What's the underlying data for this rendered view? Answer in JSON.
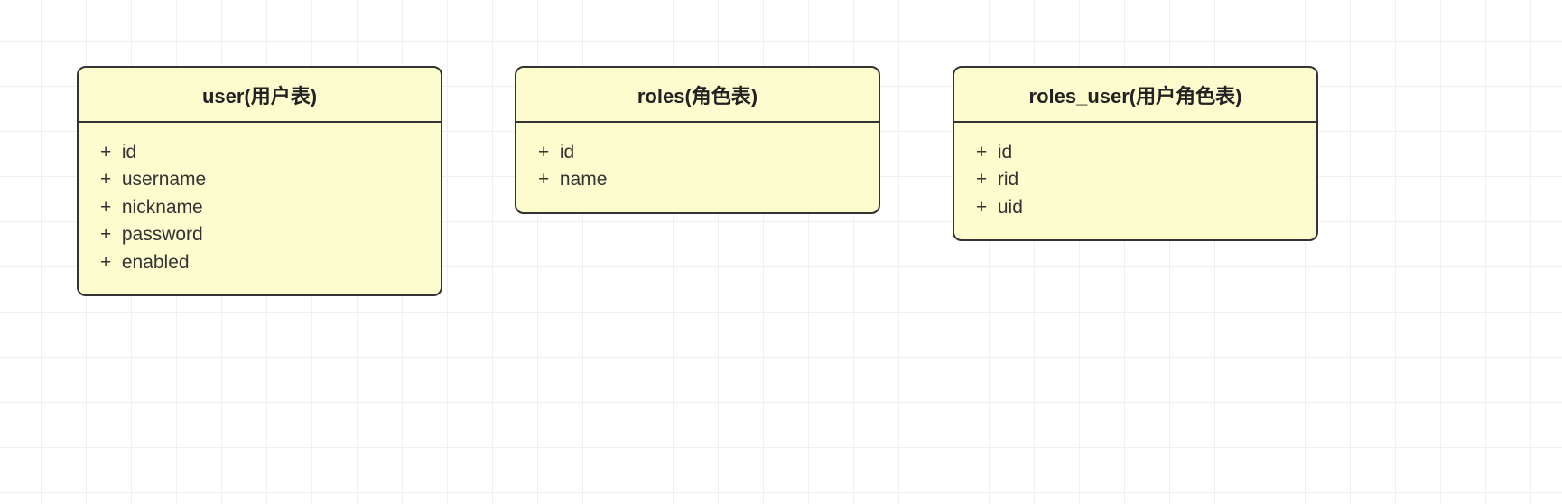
{
  "entities": [
    {
      "key": "user",
      "title": "user(用户表)",
      "fields": [
        "id",
        "username",
        "nickname",
        "password",
        "enabled"
      ]
    },
    {
      "key": "roles",
      "title": "roles(角色表)",
      "fields": [
        "id",
        "name"
      ]
    },
    {
      "key": "roles_user",
      "title": "roles_user(用户角色表)",
      "fields": [
        "id",
        "rid",
        "uid"
      ]
    }
  ],
  "field_prefix": "+"
}
